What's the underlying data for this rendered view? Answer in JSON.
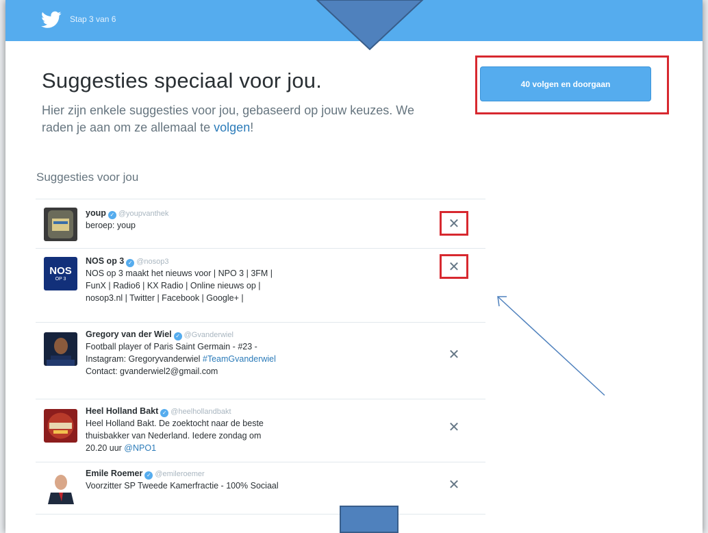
{
  "header": {
    "step_label": "Stap 3 van 6"
  },
  "main": {
    "title": "Suggesties speciaal voor jou.",
    "subtitle_pre": "Hier zijn enkele suggesties voor jou, gebaseerd op jouw keuzes. We raden je aan om ze allemaal te ",
    "subtitle_link": "volgen",
    "subtitle_post": "!",
    "follow_button_label": "40 volgen en doorgaan",
    "section_title": "Suggesties voor jou"
  },
  "suggestions": [
    {
      "name": "youp",
      "handle": "@youpvanthek",
      "bio": "beroep: youp",
      "dismiss": "✕"
    },
    {
      "name": "NOS op 3",
      "handle": "@nosop3",
      "bio": "NOS op 3 maakt het nieuws voor | NPO 3 | 3FM | FunX | Radio6 | KX Radio | Online nieuws op | nosop3.nl | Twitter | Facebook | Google+ |",
      "avatar_text": "NOS",
      "avatar_sub": "OP 3",
      "dismiss": "✕"
    },
    {
      "name": "Gregory van der Wiel",
      "handle": "@Gvanderwiel",
      "bio_pre": "Football player of Paris Saint Germain - #23 - Instagram: Gregoryvanderwiel ",
      "bio_link": "#TeamGvanderwiel",
      "bio_post": " Contact: gvanderwiel2@gmail.com",
      "dismiss": "✕"
    },
    {
      "name": "Heel Holland Bakt",
      "handle": "@heelhollandbakt",
      "bio_pre": "Heel Holland Bakt.  De zoektocht naar de beste thuisbakker van Nederland. Iedere zondag om 20.20 uur ",
      "bio_link": "@NPO1",
      "dismiss": "✕"
    },
    {
      "name": "Emile Roemer",
      "handle": "@emileroemer",
      "bio": "Voorzitter SP Tweede Kamerfractie - 100% Sociaal",
      "dismiss": "✕"
    }
  ],
  "icons": {
    "logo": "twitter-bird-icon",
    "verified": "verified-badge-icon",
    "dismiss": "close-icon"
  },
  "colors": {
    "brand": "#55acee",
    "link": "#2b7bb9",
    "highlight": "#d7282f",
    "annotation": "#4f81bd"
  }
}
